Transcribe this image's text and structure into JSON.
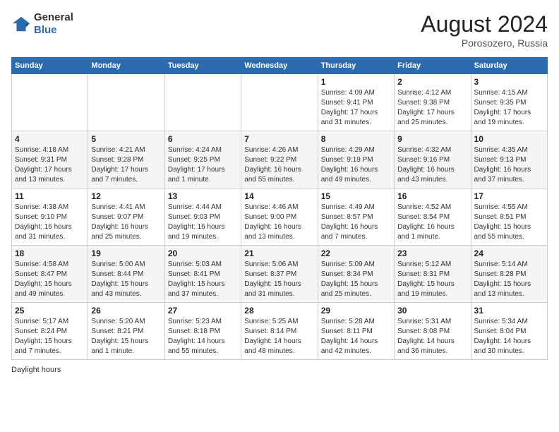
{
  "header": {
    "logo_line1": "General",
    "logo_line2": "Blue",
    "month_year": "August 2024",
    "location": "Porosozero, Russia"
  },
  "days_of_week": [
    "Sunday",
    "Monday",
    "Tuesday",
    "Wednesday",
    "Thursday",
    "Friday",
    "Saturday"
  ],
  "weeks": [
    [
      {
        "day": "",
        "info": ""
      },
      {
        "day": "",
        "info": ""
      },
      {
        "day": "",
        "info": ""
      },
      {
        "day": "",
        "info": ""
      },
      {
        "day": "1",
        "info": "Sunrise: 4:09 AM\nSunset: 9:41 PM\nDaylight: 17 hours and 31 minutes."
      },
      {
        "day": "2",
        "info": "Sunrise: 4:12 AM\nSunset: 9:38 PM\nDaylight: 17 hours and 25 minutes."
      },
      {
        "day": "3",
        "info": "Sunrise: 4:15 AM\nSunset: 9:35 PM\nDaylight: 17 hours and 19 minutes."
      }
    ],
    [
      {
        "day": "4",
        "info": "Sunrise: 4:18 AM\nSunset: 9:31 PM\nDaylight: 17 hours and 13 minutes."
      },
      {
        "day": "5",
        "info": "Sunrise: 4:21 AM\nSunset: 9:28 PM\nDaylight: 17 hours and 7 minutes."
      },
      {
        "day": "6",
        "info": "Sunrise: 4:24 AM\nSunset: 9:25 PM\nDaylight: 17 hours and 1 minute."
      },
      {
        "day": "7",
        "info": "Sunrise: 4:26 AM\nSunset: 9:22 PM\nDaylight: 16 hours and 55 minutes."
      },
      {
        "day": "8",
        "info": "Sunrise: 4:29 AM\nSunset: 9:19 PM\nDaylight: 16 hours and 49 minutes."
      },
      {
        "day": "9",
        "info": "Sunrise: 4:32 AM\nSunset: 9:16 PM\nDaylight: 16 hours and 43 minutes."
      },
      {
        "day": "10",
        "info": "Sunrise: 4:35 AM\nSunset: 9:13 PM\nDaylight: 16 hours and 37 minutes."
      }
    ],
    [
      {
        "day": "11",
        "info": "Sunrise: 4:38 AM\nSunset: 9:10 PM\nDaylight: 16 hours and 31 minutes."
      },
      {
        "day": "12",
        "info": "Sunrise: 4:41 AM\nSunset: 9:07 PM\nDaylight: 16 hours and 25 minutes."
      },
      {
        "day": "13",
        "info": "Sunrise: 4:44 AM\nSunset: 9:03 PM\nDaylight: 16 hours and 19 minutes."
      },
      {
        "day": "14",
        "info": "Sunrise: 4:46 AM\nSunset: 9:00 PM\nDaylight: 16 hours and 13 minutes."
      },
      {
        "day": "15",
        "info": "Sunrise: 4:49 AM\nSunset: 8:57 PM\nDaylight: 16 hours and 7 minutes."
      },
      {
        "day": "16",
        "info": "Sunrise: 4:52 AM\nSunset: 8:54 PM\nDaylight: 16 hours and 1 minute."
      },
      {
        "day": "17",
        "info": "Sunrise: 4:55 AM\nSunset: 8:51 PM\nDaylight: 15 hours and 55 minutes."
      }
    ],
    [
      {
        "day": "18",
        "info": "Sunrise: 4:58 AM\nSunset: 8:47 PM\nDaylight: 15 hours and 49 minutes."
      },
      {
        "day": "19",
        "info": "Sunrise: 5:00 AM\nSunset: 8:44 PM\nDaylight: 15 hours and 43 minutes."
      },
      {
        "day": "20",
        "info": "Sunrise: 5:03 AM\nSunset: 8:41 PM\nDaylight: 15 hours and 37 minutes."
      },
      {
        "day": "21",
        "info": "Sunrise: 5:06 AM\nSunset: 8:37 PM\nDaylight: 15 hours and 31 minutes."
      },
      {
        "day": "22",
        "info": "Sunrise: 5:09 AM\nSunset: 8:34 PM\nDaylight: 15 hours and 25 minutes."
      },
      {
        "day": "23",
        "info": "Sunrise: 5:12 AM\nSunset: 8:31 PM\nDaylight: 15 hours and 19 minutes."
      },
      {
        "day": "24",
        "info": "Sunrise: 5:14 AM\nSunset: 8:28 PM\nDaylight: 15 hours and 13 minutes."
      }
    ],
    [
      {
        "day": "25",
        "info": "Sunrise: 5:17 AM\nSunset: 8:24 PM\nDaylight: 15 hours and 7 minutes."
      },
      {
        "day": "26",
        "info": "Sunrise: 5:20 AM\nSunset: 8:21 PM\nDaylight: 15 hours and 1 minute."
      },
      {
        "day": "27",
        "info": "Sunrise: 5:23 AM\nSunset: 8:18 PM\nDaylight: 14 hours and 55 minutes."
      },
      {
        "day": "28",
        "info": "Sunrise: 5:25 AM\nSunset: 8:14 PM\nDaylight: 14 hours and 48 minutes."
      },
      {
        "day": "29",
        "info": "Sunrise: 5:28 AM\nSunset: 8:11 PM\nDaylight: 14 hours and 42 minutes."
      },
      {
        "day": "30",
        "info": "Sunrise: 5:31 AM\nSunset: 8:08 PM\nDaylight: 14 hours and 36 minutes."
      },
      {
        "day": "31",
        "info": "Sunrise: 5:34 AM\nSunset: 8:04 PM\nDaylight: 14 hours and 30 minutes."
      }
    ]
  ],
  "footer": {
    "daylight_label": "Daylight hours"
  }
}
